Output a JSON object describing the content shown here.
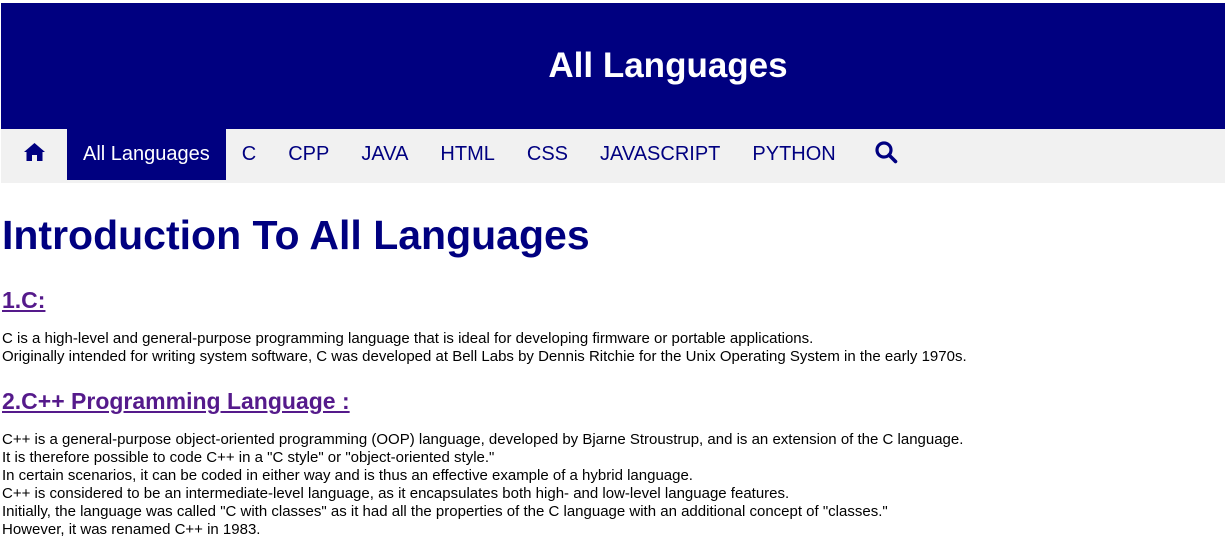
{
  "header": {
    "title": "All Languages"
  },
  "nav": {
    "home_icon": "home-icon",
    "items": [
      {
        "label": "All Languages",
        "active": true
      },
      {
        "label": "C"
      },
      {
        "label": "CPP"
      },
      {
        "label": "JAVA"
      },
      {
        "label": "HTML"
      },
      {
        "label": "CSS"
      },
      {
        "label": "JAVASCRIPT"
      },
      {
        "label": "PYTHON"
      }
    ],
    "search_icon": "search-icon"
  },
  "main": {
    "title": "Introduction To All Languages",
    "sections": [
      {
        "heading": "1.C:",
        "lines": [
          "C is a high-level and general-purpose programming language that is ideal for developing firmware or portable applications.",
          "Originally intended for writing system software, C was developed at Bell Labs by Dennis Ritchie for the Unix Operating System in the early 1970s."
        ]
      },
      {
        "heading": "2.C++ Programming Language :",
        "lines": [
          "C++ is a general-purpose object-oriented programming (OOP) language, developed by Bjarne Stroustrup, and is an extension of the C language.",
          "It is therefore possible to code C++ in a \"C style\" or \"object-oriented style.\"",
          "In certain scenarios, it can be coded in either way and is thus an effective example of a hybrid language.",
          "C++ is considered to be an intermediate-level language, as it encapsulates both high- and low-level language features.",
          "Initially, the language was called \"C with classes\" as it had all the properties of the C language with an additional concept of \"classes.\"",
          "However, it was renamed C++ in 1983."
        ]
      }
    ]
  },
  "colors": {
    "primary": "#000080",
    "nav_bg": "#f1f1f1",
    "link_visited": "#551a8b"
  }
}
